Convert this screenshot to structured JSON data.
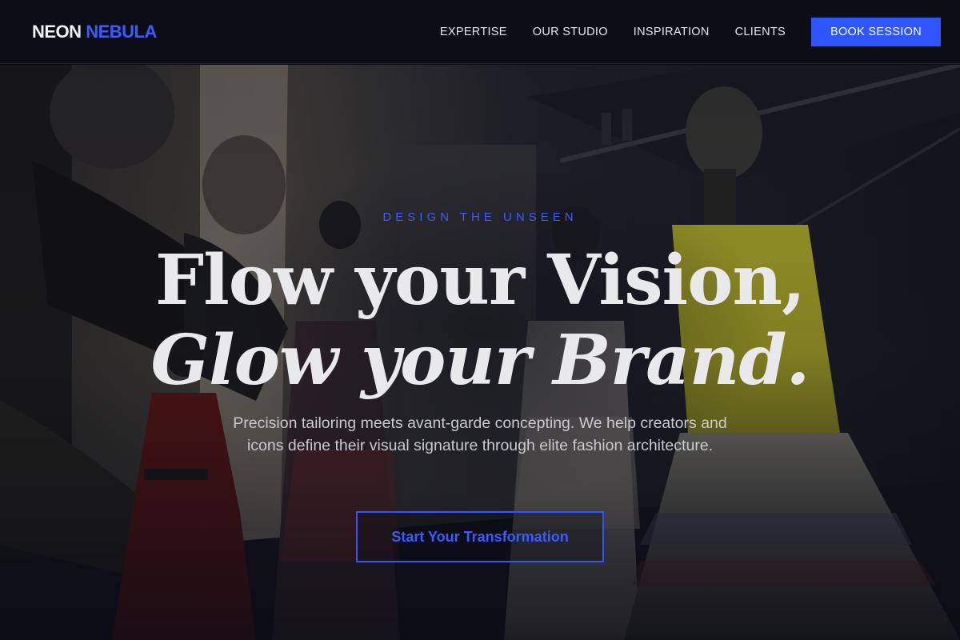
{
  "brand": {
    "word1": "NEON",
    "word2": "NEBULA"
  },
  "nav": {
    "items": [
      {
        "label": "EXPERTISE"
      },
      {
        "label": "OUR STUDIO"
      },
      {
        "label": "INSPIRATION"
      },
      {
        "label": "CLIENTS"
      }
    ],
    "cta_label": "BOOK SESSION"
  },
  "hero": {
    "eyebrow": "DESIGN THE UNSEEN",
    "headline_line1": "Flow your Vision,",
    "headline_line2": "Glow your Brand.",
    "description": "Precision tailoring meets avant-garde concepting. We help creators and icons define their visual signature through elite fashion architecture.",
    "cta_label": "Start Your Transformation"
  },
  "colors": {
    "accent": "#2f55ff",
    "background": "#0b0c14",
    "text": "#e9e9ec"
  }
}
